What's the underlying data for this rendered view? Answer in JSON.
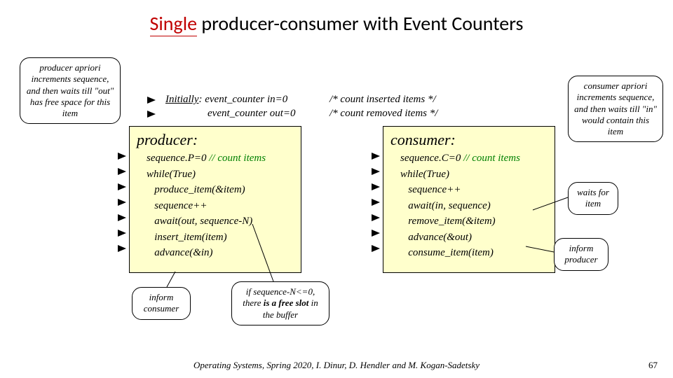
{
  "title": {
    "single": "Single",
    "rest": " producer-consumer with Event Counters"
  },
  "callouts": {
    "producer_note": "producer apriori increments sequence, and then waits till \"out\" has free space for this item",
    "consumer_note": "consumer apriori increments sequence, and then waits till \"in\" would contain this item",
    "inform_consumer": "inform consumer",
    "free_slot": "if sequence-N<=0, there is a free slot in the buffer",
    "waits_item": "waits for item",
    "inform_producer": "inform producer"
  },
  "init": {
    "label": "Initially",
    "line1": ": event_counter in=0",
    "line2": "event_counter out=0",
    "comment1": "/* count inserted items */",
    "comment2": "/* count removed items */"
  },
  "producer": {
    "header": "producer:",
    "l1a": "sequence.P=0 ",
    "l1b": "// count items",
    "l2": "while(True)",
    "l3": "   produce_item(&item)",
    "l4": "   sequence++",
    "l5": "   await(out, sequence-N)",
    "l6": "   insert_item(item)",
    "l7": "   advance(&in)"
  },
  "consumer": {
    "header": "consumer:",
    "l1a": "sequence.C=0 ",
    "l1b": "// count items",
    "l2": "while(True)",
    "l3": "   sequence++",
    "l4": "   await(in, sequence)",
    "l5": "   remove_item(&item)",
    "l6": "   advance(&out)",
    "l7": "   consume_item(item)"
  },
  "footer": "Operating Systems, Spring 2020, I. Dinur,  D. Hendler and M. Kogan-Sadetsky",
  "pagenum": "67"
}
